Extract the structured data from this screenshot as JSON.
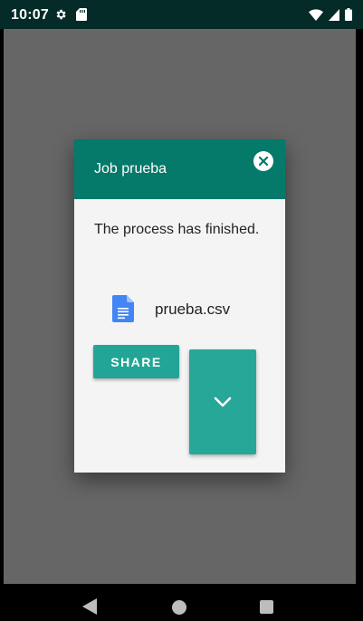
{
  "status_bar": {
    "time": "10:07",
    "left_icons": [
      "settings-icon",
      "sd-card-icon"
    ],
    "right_icons": [
      "wifi-icon",
      "cell-signal-icon",
      "battery-icon"
    ]
  },
  "dialog": {
    "title": "Job prueba",
    "message": "The process has finished.",
    "file_name": "prueba.csv",
    "file_icon": "google-docs-file-icon",
    "share_label": "SHARE",
    "expand_icon": "chevron-down-icon",
    "close_icon": "close-icon"
  },
  "nav_bar": {
    "buttons": [
      "back-icon",
      "home-icon",
      "recents-icon"
    ]
  },
  "colors": {
    "status_bar": "#042b27",
    "header": "#05796a",
    "accent": "#22a596",
    "scrim": "#666666",
    "dialog_bg": "#f4f4f4",
    "doc_icon": "#4285f4"
  }
}
